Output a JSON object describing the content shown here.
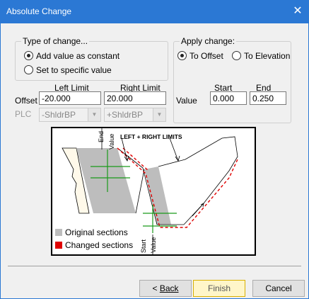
{
  "window": {
    "title": "Absolute Change",
    "close_glyph": "✕"
  },
  "type_of_change": {
    "legend": "Type of change...",
    "options": [
      {
        "label": "Add value as constant",
        "selected": true
      },
      {
        "label": "Set to specific value",
        "selected": false
      }
    ]
  },
  "apply_change": {
    "legend": "Apply change:",
    "options": [
      {
        "label": "To Offset",
        "selected": true
      },
      {
        "label": "To Elevation",
        "selected": false
      }
    ]
  },
  "limits": {
    "left_header": "Left Limit",
    "right_header": "Right Limit",
    "offset_label": "Offset",
    "plc_label": "PLC",
    "offset_left": "-20.000",
    "offset_right": "20.000",
    "plc_left": "-ShldrBP",
    "plc_right": "+ShldrBP"
  },
  "value": {
    "label": "Value",
    "start_header": "Start",
    "end_header": "End",
    "start": "0.000",
    "end": "0.250"
  },
  "diagram": {
    "end_label": "End",
    "value_label": "Value",
    "start_label": "Start",
    "limits_label": "LEFT + RIGHT LIMITS",
    "legend_original": "Original sections",
    "legend_changed": "Changed sections",
    "original_color": "#bdbdbd",
    "changed_color": "#e00000"
  },
  "buttons": {
    "back_label": "Back",
    "back_prefix": "< ",
    "finish_label": "Finish",
    "cancel_label": "Cancel"
  }
}
